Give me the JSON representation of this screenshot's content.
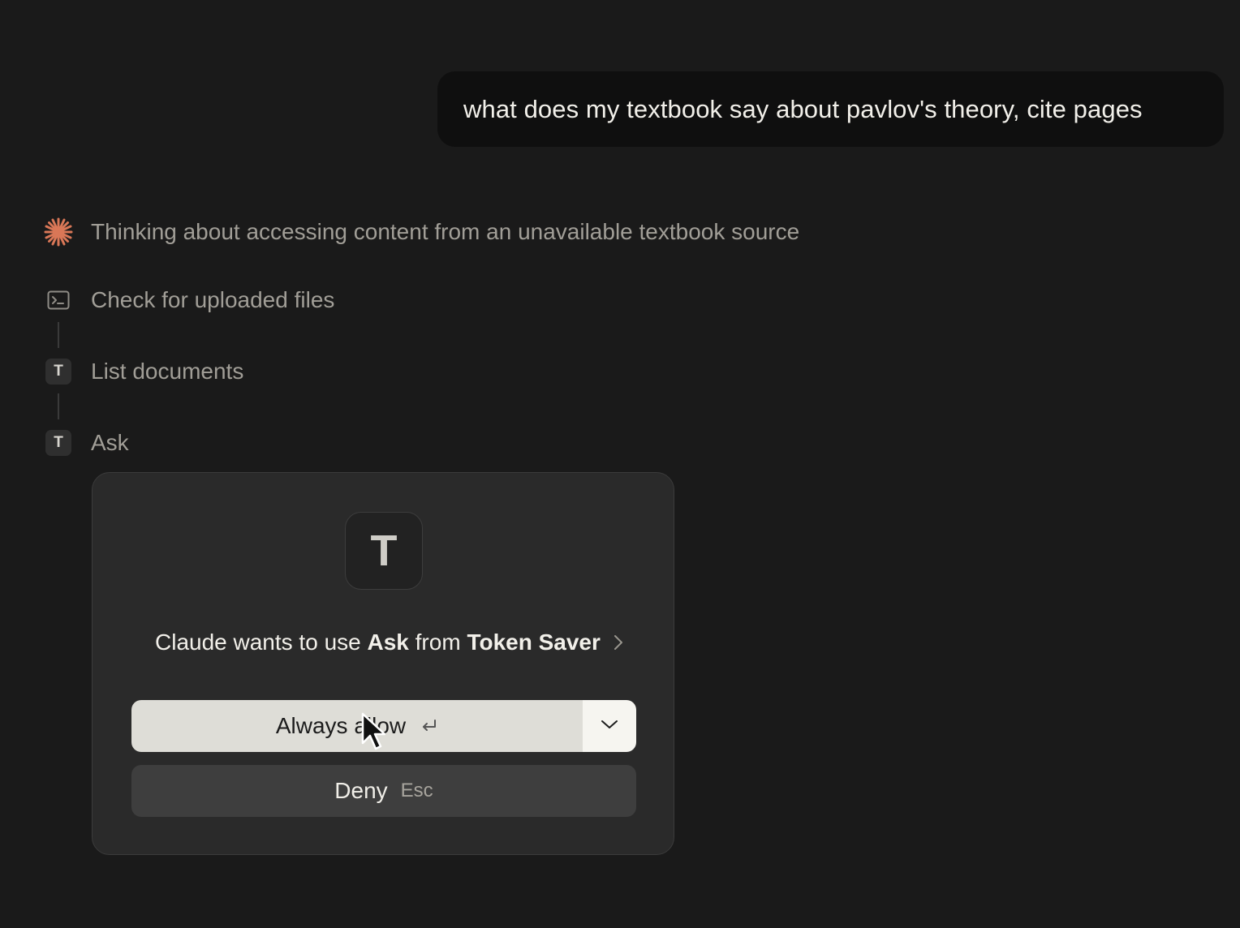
{
  "user_message": "what does my textbook say about pavlov's theory, cite pages",
  "thinking": {
    "label": "Thinking about accessing content from an unavailable textbook source",
    "icon": "claude-spark-icon",
    "accent": "#d97757"
  },
  "steps": [
    {
      "icon": "terminal-icon",
      "label": "Check for uploaded files"
    },
    {
      "icon": "tool-t-icon",
      "badge": "T",
      "label": "List documents"
    },
    {
      "icon": "tool-t-icon",
      "badge": "T",
      "label": "Ask"
    }
  ],
  "permission_dialog": {
    "tool_icon_letter": "T",
    "text_prefix": "Claude wants to use",
    "tool_name": "Ask",
    "text_from": "from",
    "server_name": "Token Saver",
    "allow_label": "Always allow",
    "allow_shortcut_icon": "return-key-icon",
    "deny_label": "Deny",
    "deny_shortcut": "Esc"
  },
  "colors": {
    "background": "#1a1a1a",
    "user_bubble": "#0f0f0f",
    "dialog": "#2a2a2a",
    "allow_button": "#deddd7",
    "deny_button": "#3e3e3e"
  }
}
